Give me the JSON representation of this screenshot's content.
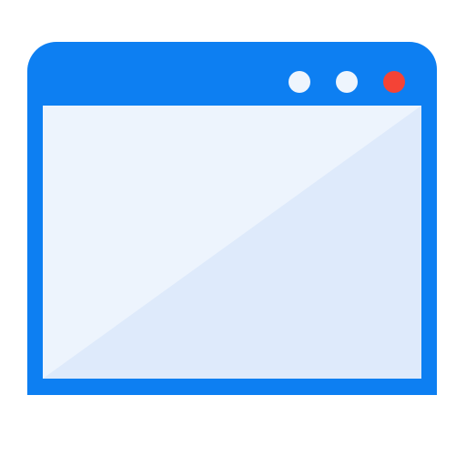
{
  "icon": {
    "name": "browser-window-icon",
    "colors": {
      "frame": "#0d7ff2",
      "title_dot_light": "#eef5fd",
      "close_dot": "#f44336",
      "content_light": "#edf4fd",
      "content_shade": "#deeafb"
    }
  }
}
